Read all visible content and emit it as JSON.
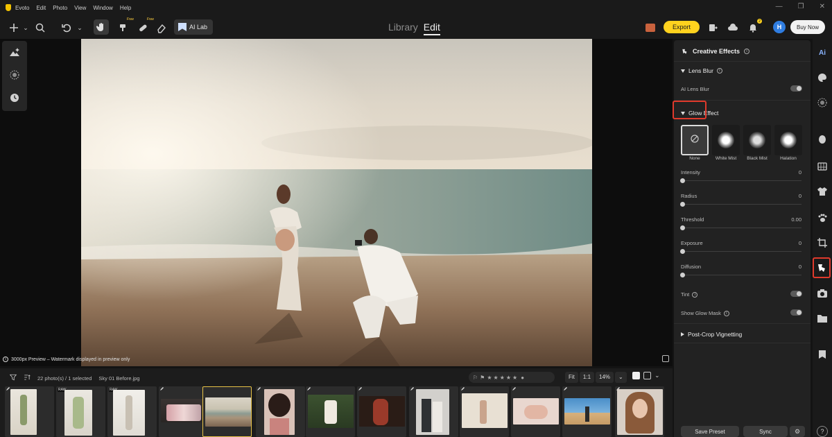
{
  "app": {
    "title_menu": [
      "Evoto",
      "Edit",
      "Photo",
      "View",
      "Window",
      "Help"
    ]
  },
  "toolbar": {
    "free_label": "Free",
    "ai_lab_label": "AI Lab",
    "mode_library": "Library",
    "mode_edit": "Edit",
    "export_label": "Export",
    "notification_count": "2",
    "avatar_initial": "H",
    "buy_now_label": "Buy Now"
  },
  "canvas": {
    "preview_note": "3000px Preview – Watermark displayed in preview only"
  },
  "panel": {
    "title": "Creative Effects",
    "lens_blur": {
      "header": "Lens Blur",
      "ai_lens_blur_label": "AI Lens Blur"
    },
    "glow_effect": {
      "header": "Glow Effect",
      "presets": [
        "None",
        "White Mist",
        "Black Mist",
        "Halation"
      ],
      "sliders": [
        {
          "label": "Intensity",
          "value": "0"
        },
        {
          "label": "Radius",
          "value": "0"
        },
        {
          "label": "Threshold",
          "value": "0.00"
        },
        {
          "label": "Exposure",
          "value": "0"
        },
        {
          "label": "Diffusion",
          "value": "0"
        }
      ],
      "tint_label": "Tint",
      "show_glow_mask_label": "Show Glow Mask"
    },
    "post_crop_vignetting": "Post-Crop Vignetting",
    "save_preset_label": "Save Preset",
    "sync_label": "Sync"
  },
  "filmstrip": {
    "photo_count": "22 photo(s) / 1 selected",
    "current_file": "Sky 01 Before.jpg",
    "zoom_fit": "Fit",
    "zoom_one": "1:1",
    "zoom_percent": "14%",
    "raw_label": "RAW",
    "thumbnails": [
      {
        "raw": false,
        "edited": true
      },
      {
        "raw": true,
        "edited": true
      },
      {
        "raw": true,
        "edited": false
      },
      {
        "raw": false,
        "edited": true
      },
      {
        "raw": false,
        "edited": false
      },
      {
        "raw": false,
        "edited": true
      },
      {
        "raw": false,
        "edited": true
      },
      {
        "raw": false,
        "edited": true
      },
      {
        "raw": false,
        "edited": true
      },
      {
        "raw": false,
        "edited": true
      },
      {
        "raw": false,
        "edited": true
      },
      {
        "raw": false,
        "edited": true
      },
      {
        "raw": false,
        "edited": true
      }
    ]
  },
  "colors": {
    "accent_yellow": "#ffd21e",
    "highlight_red": "#e03a2c",
    "avatar_blue": "#2f7de1"
  }
}
